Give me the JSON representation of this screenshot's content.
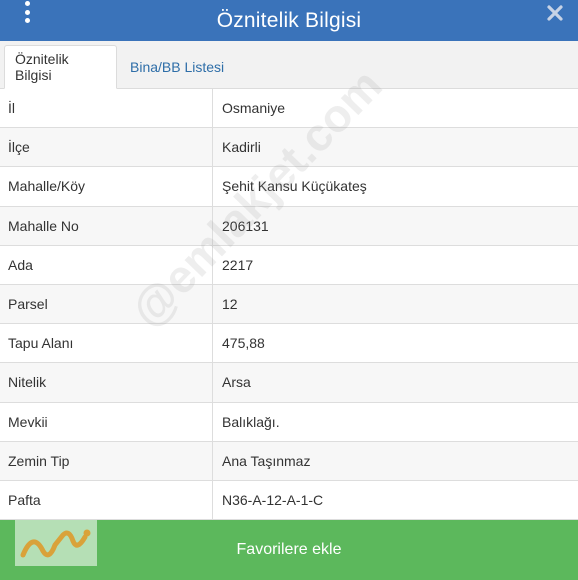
{
  "header": {
    "title": "Öznitelik Bilgisi"
  },
  "tabs": [
    {
      "label": "Öznitelik Bilgisi",
      "active": true
    },
    {
      "label": "Bina/BB Listesi",
      "active": false
    }
  ],
  "rows": [
    {
      "key": "İl",
      "value": "Osmaniye"
    },
    {
      "key": "İlçe",
      "value": "Kadirli"
    },
    {
      "key": "Mahalle/Köy",
      "value": "Şehit Kansu Küçükateş"
    },
    {
      "key": "Mahalle No",
      "value": "206131"
    },
    {
      "key": "Ada",
      "value": "2217"
    },
    {
      "key": "Parsel",
      "value": "12"
    },
    {
      "key": "Tapu Alanı",
      "value": "475,88"
    },
    {
      "key": "Nitelik",
      "value": "Arsa"
    },
    {
      "key": "Mevkii",
      "value": "Balıklağı."
    },
    {
      "key": "Zemin Tip",
      "value": "Ana Taşınmaz"
    },
    {
      "key": "Pafta",
      "value": "N36-A-12-A-1-C"
    }
  ],
  "watermark": "@emlakjet.com",
  "footer": {
    "button_label": "Favorilere ekle"
  },
  "colors": {
    "header": "#3a73ba",
    "tab_link": "#2e6ea8",
    "button": "#5cb85c"
  },
  "icons": {
    "menu": "vertical-dots-icon",
    "close": "close-icon",
    "logo": "emlakjet-logo-icon"
  }
}
